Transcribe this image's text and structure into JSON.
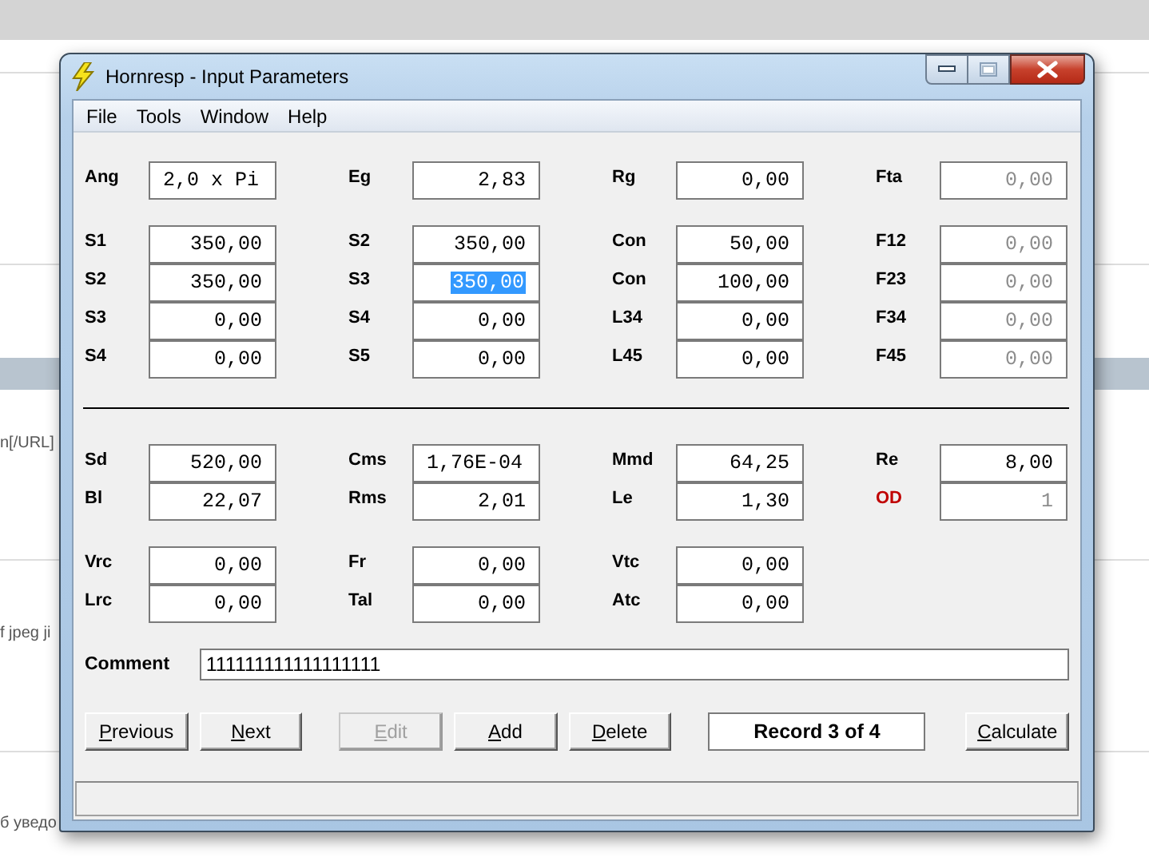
{
  "background": {
    "texts": [
      "n[/URL]",
      "f jpeg ji",
      "б уведо"
    ]
  },
  "window": {
    "title": "Hornresp - Input Parameters"
  },
  "menu": [
    "File",
    "Tools",
    "Window",
    "Help"
  ],
  "panels": [
    {
      "groups": [
        {
          "rows": [
            [
              {
                "label": "Ang",
                "value": "2,0 x Pi",
                "kind": "text",
                "disabled": false,
                "selected": false,
                "label_alert": false
              },
              {
                "label": "Eg",
                "value": "2,83",
                "kind": "number",
                "disabled": false,
                "selected": false,
                "label_alert": false
              },
              {
                "label": "Rg",
                "value": "0,00",
                "kind": "number",
                "disabled": false,
                "selected": false,
                "label_alert": false
              },
              {
                "label": "Fta",
                "value": "0,00",
                "kind": "number",
                "disabled": true,
                "selected": false,
                "label_alert": false
              }
            ]
          ]
        },
        {
          "rows": [
            [
              {
                "label": "S1",
                "value": "350,00",
                "kind": "number",
                "disabled": false,
                "selected": false,
                "label_alert": false
              },
              {
                "label": "S2",
                "value": "350,00",
                "kind": "number",
                "disabled": false,
                "selected": false,
                "label_alert": false
              },
              {
                "label": "Con",
                "value": "50,00",
                "kind": "number",
                "disabled": false,
                "selected": false,
                "label_alert": false
              },
              {
                "label": "F12",
                "value": "0,00",
                "kind": "number",
                "disabled": true,
                "selected": false,
                "label_alert": false
              }
            ],
            [
              {
                "label": "S2",
                "value": "350,00",
                "kind": "number",
                "disabled": false,
                "selected": false,
                "label_alert": false
              },
              {
                "label": "S3",
                "value": "350,00",
                "kind": "number",
                "disabled": false,
                "selected": true,
                "label_alert": false
              },
              {
                "label": "Con",
                "value": "100,00",
                "kind": "number",
                "disabled": false,
                "selected": false,
                "label_alert": false
              },
              {
                "label": "F23",
                "value": "0,00",
                "kind": "number",
                "disabled": true,
                "selected": false,
                "label_alert": false
              }
            ],
            [
              {
                "label": "S3",
                "value": "0,00",
                "kind": "number",
                "disabled": false,
                "selected": false,
                "label_alert": false
              },
              {
                "label": "S4",
                "value": "0,00",
                "kind": "number",
                "disabled": false,
                "selected": false,
                "label_alert": false
              },
              {
                "label": "L34",
                "value": "0,00",
                "kind": "number",
                "disabled": false,
                "selected": false,
                "label_alert": false
              },
              {
                "label": "F34",
                "value": "0,00",
                "kind": "number",
                "disabled": true,
                "selected": false,
                "label_alert": false
              }
            ],
            [
              {
                "label": "S4",
                "value": "0,00",
                "kind": "number",
                "disabled": false,
                "selected": false,
                "label_alert": false
              },
              {
                "label": "S5",
                "value": "0,00",
                "kind": "number",
                "disabled": false,
                "selected": false,
                "label_alert": false
              },
              {
                "label": "L45",
                "value": "0,00",
                "kind": "number",
                "disabled": false,
                "selected": false,
                "label_alert": false
              },
              {
                "label": "F45",
                "value": "0,00",
                "kind": "number",
                "disabled": true,
                "selected": false,
                "label_alert": false
              }
            ]
          ]
        }
      ]
    },
    {
      "groups": [
        {
          "rows": [
            [
              {
                "label": "Sd",
                "value": "520,00",
                "kind": "number",
                "disabled": false,
                "selected": false,
                "label_alert": false
              },
              {
                "label": "Cms",
                "value": "1,76E-04",
                "kind": "text",
                "disabled": false,
                "selected": false,
                "label_alert": false
              },
              {
                "label": "Mmd",
                "value": "64,25",
                "kind": "number",
                "disabled": false,
                "selected": false,
                "label_alert": false
              },
              {
                "label": "Re",
                "value": "8,00",
                "kind": "number",
                "disabled": false,
                "selected": false,
                "label_alert": false
              }
            ],
            [
              {
                "label": "Bl",
                "value": "22,07",
                "kind": "number",
                "disabled": false,
                "selected": false,
                "label_alert": false
              },
              {
                "label": "Rms",
                "value": "2,01",
                "kind": "number",
                "disabled": false,
                "selected": false,
                "label_alert": false
              },
              {
                "label": "Le",
                "value": "1,30",
                "kind": "number",
                "disabled": false,
                "selected": false,
                "label_alert": false
              },
              {
                "label": "OD",
                "value": "1",
                "kind": "number",
                "disabled": true,
                "selected": false,
                "label_alert": true
              }
            ]
          ]
        },
        {
          "rows": [
            [
              {
                "label": "Vrc",
                "value": "0,00",
                "kind": "number",
                "disabled": false,
                "selected": false,
                "label_alert": false
              },
              {
                "label": "Fr",
                "value": "0,00",
                "kind": "number",
                "disabled": false,
                "selected": false,
                "label_alert": false
              },
              {
                "label": "Vtc",
                "value": "0,00",
                "kind": "number",
                "disabled": false,
                "selected": false,
                "label_alert": false
              }
            ],
            [
              {
                "label": "Lrc",
                "value": "0,00",
                "kind": "number",
                "disabled": false,
                "selected": false,
                "label_alert": false
              },
              {
                "label": "Tal",
                "value": "0,00",
                "kind": "number",
                "disabled": false,
                "selected": false,
                "label_alert": false
              },
              {
                "label": "Atc",
                "value": "0,00",
                "kind": "number",
                "disabled": false,
                "selected": false,
                "label_alert": false
              }
            ]
          ]
        }
      ]
    }
  ],
  "comment": {
    "label": "Comment",
    "value": "111111111111111111"
  },
  "buttons": [
    {
      "label": "Previous",
      "disabled": false,
      "accel": true,
      "kind": "button"
    },
    {
      "label": "Next",
      "disabled": false,
      "accel": true,
      "kind": "button"
    },
    {
      "label": "Edit",
      "disabled": true,
      "accel": true,
      "kind": "button"
    },
    {
      "label": "Add",
      "disabled": false,
      "accel": true,
      "kind": "button"
    },
    {
      "label": "Delete",
      "disabled": false,
      "accel": true,
      "kind": "button"
    },
    {
      "label": "Record 3 of 4",
      "kind": "display"
    },
    {
      "label": "Calculate",
      "disabled": false,
      "accel": true,
      "kind": "button"
    }
  ]
}
